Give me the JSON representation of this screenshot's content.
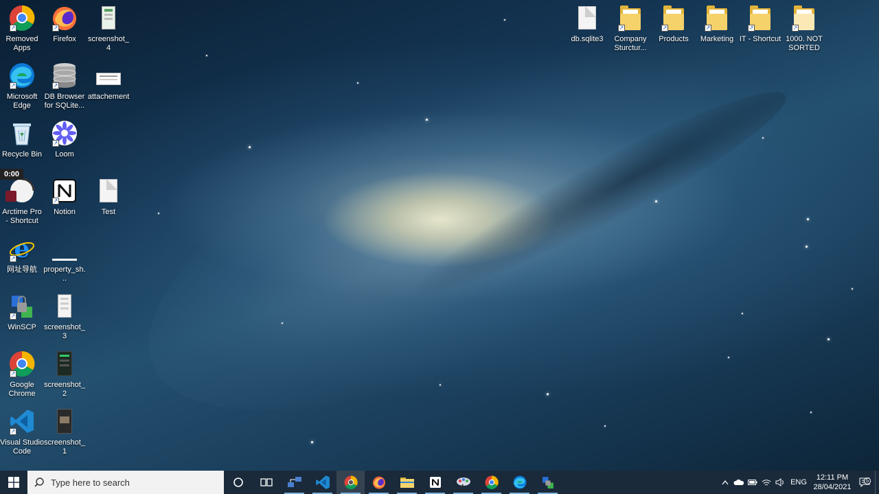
{
  "desktop": {
    "icons_left": [
      {
        "label": "Removed Apps",
        "icon": "chrome-icon"
      },
      {
        "label": "Firefox",
        "icon": "firefox-icon"
      },
      {
        "label": "screenshot_4",
        "icon": "image-file-icon"
      },
      {
        "label": "Microsoft Edge",
        "icon": "edge-icon"
      },
      {
        "label": "DB Browser for SQLite...",
        "icon": "database-icon"
      },
      {
        "label": "attachement",
        "icon": "document-file-icon"
      },
      {
        "label": "Recycle Bin",
        "icon": "recycle-bin-icon"
      },
      {
        "label": "Loom",
        "icon": "loom-icon"
      },
      {
        "label": "Arctime Pro - Shortcut",
        "icon": "arctime-icon"
      },
      {
        "label": "Notion",
        "icon": "notion-icon"
      },
      {
        "label": "Test",
        "icon": "text-file-icon"
      },
      {
        "label": "网址导航",
        "icon": "internet-explorer-icon"
      },
      {
        "label": "property_sh...",
        "icon": "document-file-icon"
      },
      {
        "label": "WinSCP",
        "icon": "winscp-icon"
      },
      {
        "label": "screenshot_3",
        "icon": "image-file-icon"
      },
      {
        "label": "Google Chrome",
        "icon": "chrome-icon"
      },
      {
        "label": "screenshot_2",
        "icon": "image-file-icon"
      },
      {
        "label": "Visual Studio Code",
        "icon": "vscode-icon"
      },
      {
        "label": "screenshot_1",
        "icon": "image-file-icon"
      }
    ],
    "icons_right": [
      {
        "label": "db.sqlite3",
        "icon": "blank-file-icon"
      },
      {
        "label": "Company Sturctur...",
        "icon": "folder-icon"
      },
      {
        "label": "Products",
        "icon": "folder-icon"
      },
      {
        "label": "Marketing",
        "icon": "folder-icon"
      },
      {
        "label": "IT - Shortcut",
        "icon": "folder-icon"
      },
      {
        "label": "1000. NOT SORTED",
        "icon": "folder-icon"
      }
    ],
    "recording_timer": "0:00"
  },
  "taskbar": {
    "search_placeholder": "Type here to search",
    "pinned": [
      {
        "name": "cortana",
        "icon": "cortana-icon"
      },
      {
        "name": "task-view",
        "icon": "task-view-icon"
      },
      {
        "name": "network-app",
        "icon": "network-app-icon"
      },
      {
        "name": "vscode",
        "icon": "vscode-icon"
      },
      {
        "name": "chrome-dev",
        "icon": "chrome-icon"
      },
      {
        "name": "firefox",
        "icon": "firefox-icon"
      },
      {
        "name": "file-explorer",
        "icon": "folder-icon"
      },
      {
        "name": "notion",
        "icon": "notion-icon"
      },
      {
        "name": "paint-app",
        "icon": "paint-icon"
      },
      {
        "name": "chrome",
        "icon": "chrome-icon"
      },
      {
        "name": "edge",
        "icon": "edge-icon"
      },
      {
        "name": "winscp",
        "icon": "winscp-icon"
      }
    ],
    "tray": {
      "language": "ENG",
      "time": "12:11 PM",
      "date": "28/04/2021",
      "notification_count": "5"
    }
  },
  "colors": {
    "taskbar_bg": "#1a2a3a",
    "search_bg": "#f2f2f2",
    "folder_yellow": "#f6d26b",
    "accent_blue": "#0078d7"
  }
}
